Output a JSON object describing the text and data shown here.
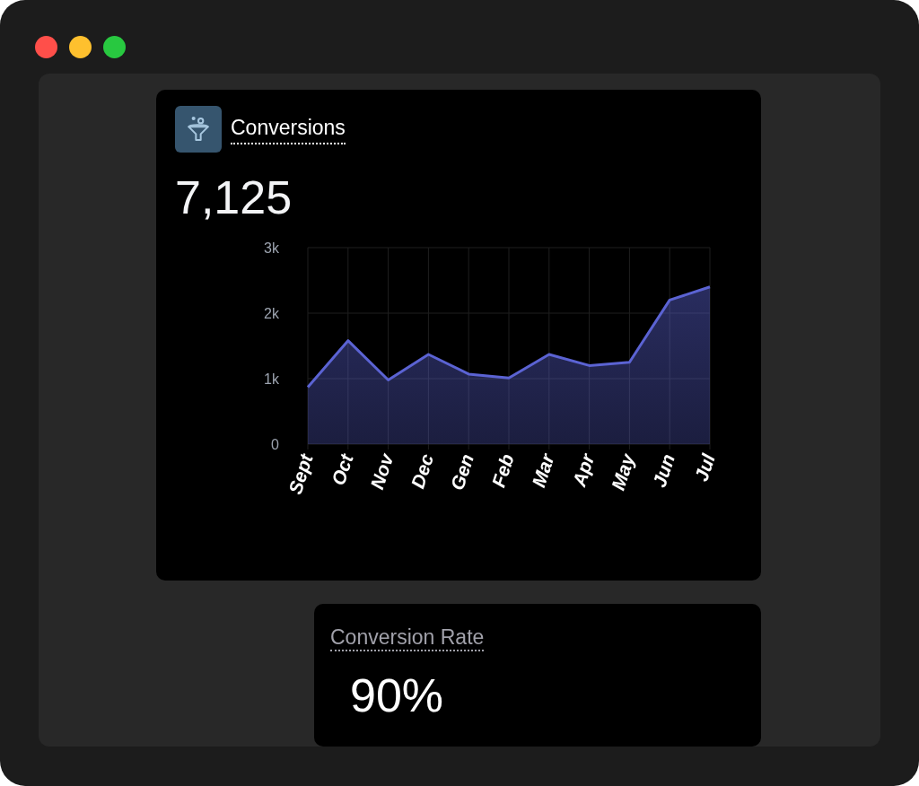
{
  "conversions": {
    "title": "Conversions",
    "value": "7,125",
    "chart_data": {
      "type": "area",
      "categories": [
        "Sept",
        "Oct",
        "Nov",
        "Dec",
        "Gen",
        "Feb",
        "Mar",
        "Apr",
        "May",
        "Jun",
        "Jul"
      ],
      "grid": true,
      "series": [
        {
          "color": "#5b63d3",
          "values": [
            870,
            1580,
            980,
            1370,
            1070,
            1010,
            1370,
            1200,
            1250,
            2200,
            2400
          ]
        }
      ],
      "ylim": [
        0,
        3000
      ],
      "yticks": [
        {
          "value": 0,
          "label": "0"
        },
        {
          "value": 1000,
          "label": "1k"
        },
        {
          "value": 2000,
          "label": "2k"
        },
        {
          "value": 3000,
          "label": "3k"
        }
      ]
    }
  },
  "conversion_rate": {
    "title": "Conversion Rate",
    "value": "90%"
  }
}
